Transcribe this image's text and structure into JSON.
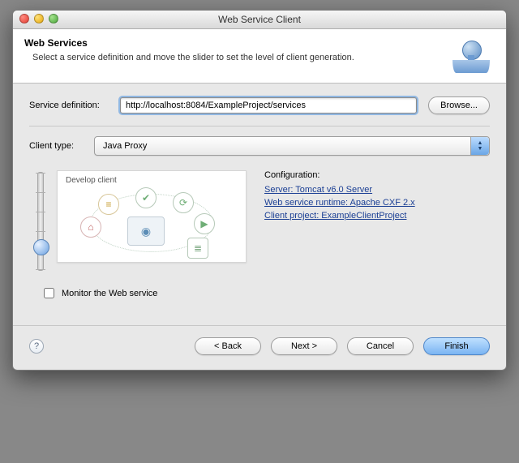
{
  "window": {
    "title": "Web Service Client"
  },
  "banner": {
    "heading": "Web Services",
    "description": "Select a service definition and move the slider to set the level of client generation."
  },
  "service_definition": {
    "label": "Service definition:",
    "value": "http://localhost:8084/ExampleProject/services",
    "browse": "Browse..."
  },
  "client_type": {
    "label": "Client type:",
    "value": "Java Proxy"
  },
  "slider": {
    "current_label": "Develop client"
  },
  "configuration": {
    "heading": "Configuration:",
    "server": "Server: Tomcat v6.0 Server",
    "runtime": "Web service runtime: Apache CXF 2.x",
    "project": "Client project: ExampleClientProject"
  },
  "monitor": {
    "label": "Monitor the Web service",
    "checked": false
  },
  "footer": {
    "back": "< Back",
    "next": "Next >",
    "cancel": "Cancel",
    "finish": "Finish"
  }
}
